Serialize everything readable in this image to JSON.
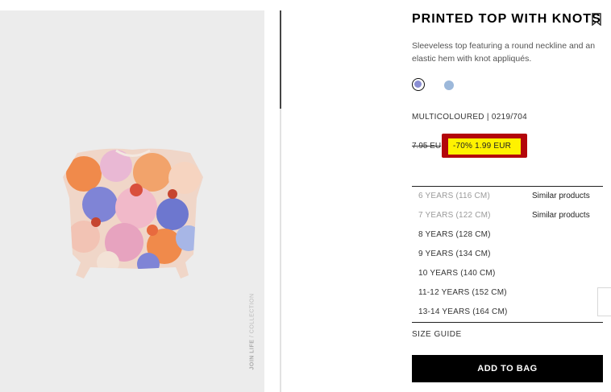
{
  "product": {
    "title": "PRINTED TOP WITH KNOTS",
    "description": "Sleeveless top featuring a round neckline and an elastic hem with knot appliqués.",
    "reference": "MULTICOLOURED | 0219/704",
    "old_price": "7.95 EU",
    "discount_price": "-70%  1.99 EUR",
    "colors": [
      "#8a8ed3",
      "#9cb8da"
    ]
  },
  "image": {
    "watermark_bold": "JOIN LIFE",
    "watermark_rest": " / COLLECTION"
  },
  "sizes": [
    {
      "label": "6 YEARS (116 CM)",
      "note": "Similar products"
    },
    {
      "label": "7 YEARS (122 CM)",
      "note": "Similar products"
    },
    {
      "label": "8 YEARS (128 CM)",
      "note": ""
    },
    {
      "label": "9 YEARS (134 CM)",
      "note": ""
    },
    {
      "label": "10 YEARS (140 CM)",
      "note": ""
    },
    {
      "label": "11-12 YEARS (152 CM)",
      "note": ""
    },
    {
      "label": "13-14 YEARS (164 CM)",
      "note": ""
    }
  ],
  "size_guide_label": "SIZE GUIDE",
  "add_to_bag_label": "ADD TO BAG"
}
